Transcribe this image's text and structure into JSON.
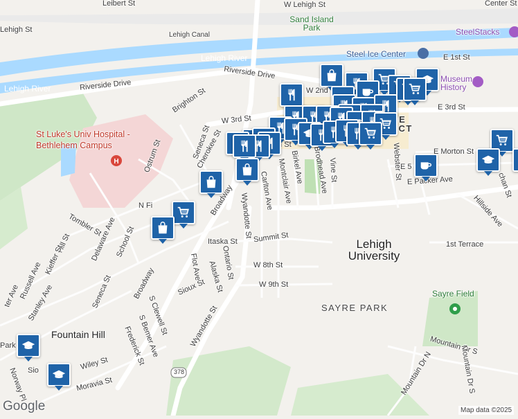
{
  "map": {
    "attribution": "Map data ©2025",
    "logo": "Google",
    "labels": {
      "leibert": "Leibert St",
      "w_lehigh": "W Lehigh St",
      "center_st": "Center St",
      "lehigh_st_top": "Lehigh St",
      "sand_island": "Sand Island Park",
      "lehigh_canal": "Lehigh Canal",
      "steelstacks": "SteelStacks",
      "lehigh_river_1": "Lehigh River",
      "lehigh_river_2": "Lehigh River",
      "steel_ice": "Steel Ice Center",
      "e_1st": "E 1st St",
      "riverside_dr1": "Riverside Drive",
      "riverside_dr2": "Riverside Drive",
      "museum": "Museum History",
      "w_2nd": "W 2nd",
      "brighton": "Brighton St",
      "e_3rd": "E 3rd St",
      "w_3rd": "W 3rd St",
      "hospital": "St Luke's Univ Hospital - Bethlehem Campus",
      "side_district": "SIDE TRICT",
      "th_st": "th St",
      "seneca_top": "Seneca St",
      "cherokee": "Cherokee St",
      "ostrum": "Ostrum St",
      "e_morton": "E Morton St",
      "e_5": "E 5",
      "webster": "Webster St",
      "vine": "Vine St",
      "montclair": "Montclair Ave",
      "birkel": "Birkel Ave",
      "brodhead": "Brodhead Ave",
      "carlton": "Carlton Ave",
      "wyandotte_mid": "Wyandotte St",
      "broadway_top": "Broadway",
      "n_fi": "N Fi",
      "e_packer": "E Packer Ave",
      "hillside": "Hillside Ave",
      "chan": "chan St",
      "tombler": "Tombler St",
      "delaware": "Delaware Ave",
      "school": "School St",
      "hill": "Hill St",
      "kieffer": "Kieffer St",
      "itaska": "Itaska St",
      "summit": "Summit St",
      "lehigh_univ": "Lehigh University",
      "first_terrace": "1st Terrace",
      "w_8th": "W 8th St",
      "w_9th": "W 9th St",
      "flot": "Flot Ave",
      "ontario": "Ontario St",
      "alaska": "Alaska St",
      "russell": "Russell Ave",
      "ter": "ter Ave",
      "stanley": "Stanley Ave",
      "seneca_low": "Seneca St",
      "broadway_low": "Broadway",
      "sioux": "Sioux St",
      "s_clewell": "S Clewell St",
      "wyandotte_low": "Wyandotte St",
      "sayre_park": "SAYRE PARK",
      "sayre_field": "Sayre Field",
      "fountain_hill": "Fountain Hill",
      "s_bemer": "S Bemer Ave",
      "frederick": "Frederick St",
      "mountain_dr_s_1": "Mountain Dr S",
      "mountain_dr_s_2": "Mountain Dr S",
      "mountain_dr_n": "Mountain Dr N",
      "wiley": "Wiley St",
      "moravia": "Moravia St",
      "norway": "Norway Pl",
      "sio": "Sio",
      "route": "378",
      "park_left": "Park"
    },
    "marker_icons": [
      "restaurant-icon",
      "shopping-bag-icon",
      "shopping-cart-icon",
      "cafe-icon",
      "school-icon"
    ]
  }
}
